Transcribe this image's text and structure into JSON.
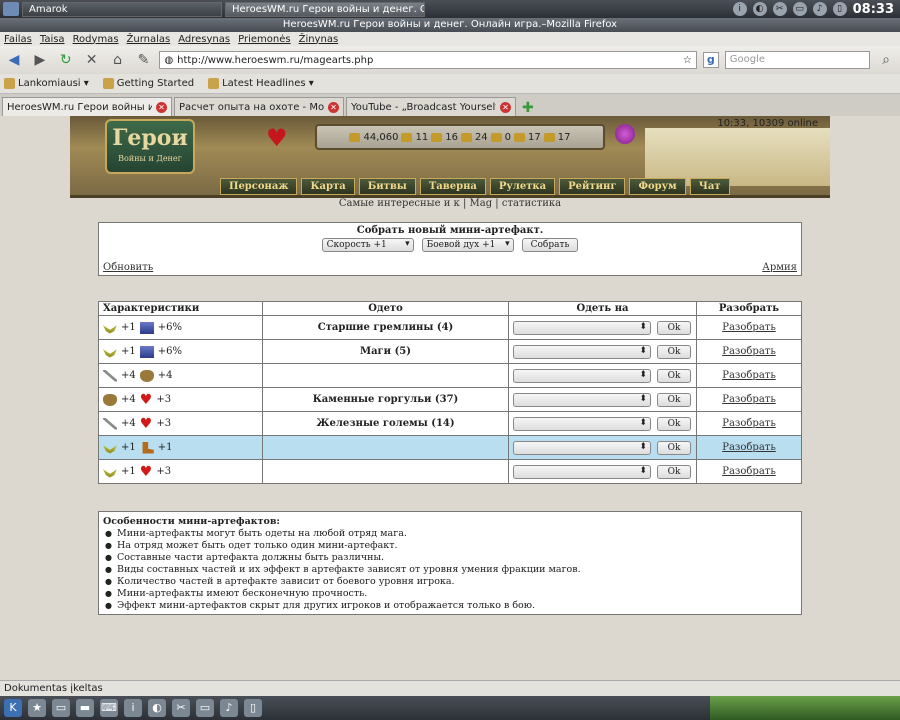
{
  "system_top": {
    "tasks": [
      "Amarok",
      "HeroesWM.ru Герои войны и денег. Онлайн и..."
    ],
    "clock": "08:33"
  },
  "window_title": "HeroesWM.ru Герои войны и денег. Онлайн игра.–Mozilla Firefox",
  "menu": [
    "Failas",
    "Taisa",
    "Rodymas",
    "Žurnalas",
    "Adresynas",
    "Priemonės",
    "Žinynas"
  ],
  "nav": {
    "url": "http://www.heroeswm.ru/magearts.php",
    "search_placeholder": "Google"
  },
  "bookmarks": [
    "Lankomiausi ▾",
    "Getting Started",
    "Latest Headlines ▾"
  ],
  "tabs": [
    "HeroesWM.ru Герои войны и д...",
    "Расчет опыта на охоте - Молот ...",
    "YouTube - „Broadcast Yourself\"."
  ],
  "game": {
    "logo_title": "Герои",
    "logo_sub": "Войны и Денег",
    "resources": [
      "44,060",
      "11",
      "16",
      "24",
      "0",
      "17",
      "17"
    ],
    "online": "10:33, 10309 online",
    "menu": [
      "Персонаж",
      "Карта",
      "Битвы",
      "Таверна",
      "Рулетка",
      "Рейтинг",
      "Форум",
      "Чат"
    ],
    "sublinks": "Самые интересные и к | Mag | статистика"
  },
  "collect": {
    "title": "Собрать новый мини-артефакт.",
    "select1": "Скорость +1",
    "select2": "Боевой дух +1",
    "button": "Собрать",
    "refresh": "Обновить",
    "army": "Армия"
  },
  "table": {
    "headers": [
      "Характеристики",
      "Одето",
      "Одеть на",
      "Разобрать"
    ],
    "rows": [
      {
        "a": "+1",
        "b": "+6%",
        "unit": "Старшие гремлины (4)"
      },
      {
        "a": "+1",
        "b": "+6%",
        "unit": "Маги (5)"
      },
      {
        "a": "+4",
        "b": "+4",
        "unit": ""
      },
      {
        "a": "+4",
        "b": "+3",
        "unit": "Каменные горгульи (37)"
      },
      {
        "a": "+4",
        "b": "+3",
        "unit": "Железные големы (14)"
      },
      {
        "a": "+1",
        "b": "+1",
        "unit": ""
      },
      {
        "a": "+1",
        "b": "+3",
        "unit": ""
      }
    ],
    "ok": "Ok",
    "disassemble": "Разобрать"
  },
  "features": {
    "title": "Особенности мини-артефактов:",
    "items": [
      "Мини-артефакты могут быть одеты на любой отряд мага.",
      "На отряд может быть одет только один мини-артефакт.",
      "Составные части артефакта должны быть различны.",
      "Виды составных частей и их эффект в артефакте зависят от уровня умения фракции магов.",
      "Количество частей в артефакте зависит от боевого уровня игрока.",
      "Мини-артефакты имеют бесконечную прочность.",
      "Эффект мини-артефактов скрыт для других игроков и отображается только в бою."
    ]
  },
  "status": "Dokumentas įkeltas"
}
